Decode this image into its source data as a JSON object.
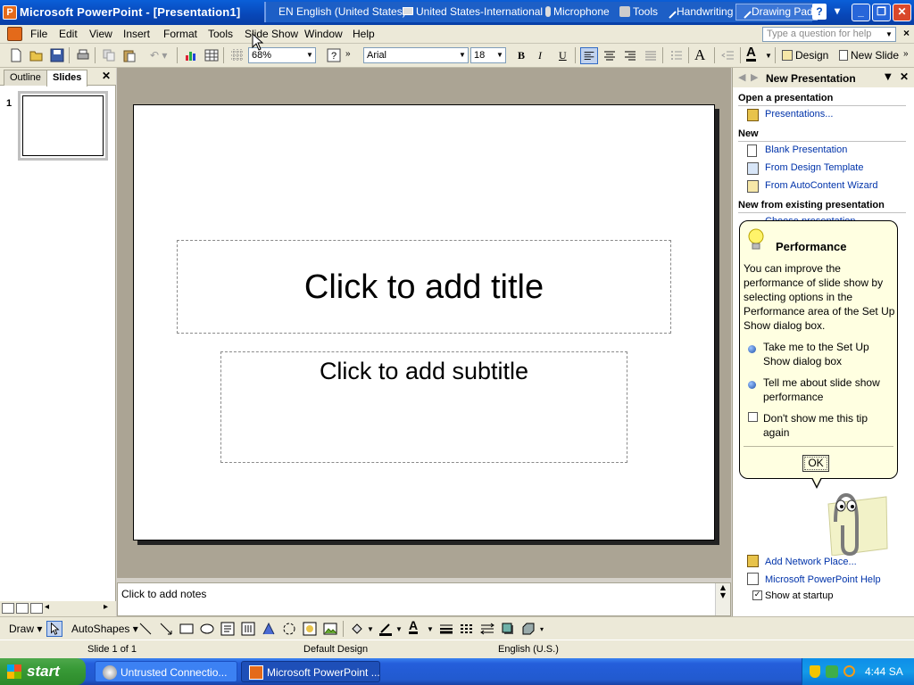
{
  "window": {
    "title": "Microsoft PowerPoint - [Presentation1]"
  },
  "language_bar": {
    "language": "EN English (United States)",
    "keyboard": "United States-International",
    "microphone": "Microphone",
    "tools": "Tools",
    "handwriting": "Handwriting",
    "drawing_pad": "Drawing Pad"
  },
  "menu": {
    "items": [
      "File",
      "Edit",
      "View",
      "Insert",
      "Format",
      "Tools",
      "Slide Show",
      "Window",
      "Help"
    ],
    "help_placeholder": "Type a question for help"
  },
  "toolbar": {
    "zoom": "68%",
    "font": "Arial",
    "font_size": "18",
    "bold": "B",
    "italic": "I",
    "underline": "U",
    "design_label": "Design",
    "new_slide_label": "New Slide"
  },
  "left_pane": {
    "tabs": [
      "Outline",
      "Slides"
    ],
    "active_tab": "Slides",
    "slide_number": "1"
  },
  "slide": {
    "title_placeholder": "Click to add title",
    "subtitle_placeholder": "Click to add subtitle"
  },
  "notes": {
    "placeholder": "Click to add notes"
  },
  "task_pane": {
    "title": "New Presentation",
    "open_heading": "Open a presentation",
    "open_link": "Presentations...",
    "new_heading": "New",
    "new_links": [
      "Blank Presentation",
      "From Design Template",
      "From AutoContent Wizard"
    ],
    "existing_heading": "New from existing presentation",
    "existing_link": "Choose presentation...",
    "bottom_links": [
      "Add Network Place...",
      "Microsoft PowerPoint Help"
    ],
    "show_at_startup": "Show at startup"
  },
  "balloon": {
    "title": "Performance",
    "body": "You can improve the performance of slide show by selecting options in the Performance area of the Set Up Show dialog box.",
    "options": [
      "Take me to the Set Up Show dialog box",
      "Tell me about slide show performance"
    ],
    "checkbox": "Don't show me this tip again",
    "ok": "OK"
  },
  "drawing_toolbar": {
    "draw": "Draw",
    "autoshapes": "AutoShapes"
  },
  "status_bar": {
    "slide": "Slide 1 of 1",
    "design": "Default Design",
    "language": "English (U.S.)"
  },
  "taskbar": {
    "start": "start",
    "tasks": [
      "Untrusted Connectio...",
      "Microsoft PowerPoint ..."
    ],
    "clock": "4:44 SA"
  }
}
